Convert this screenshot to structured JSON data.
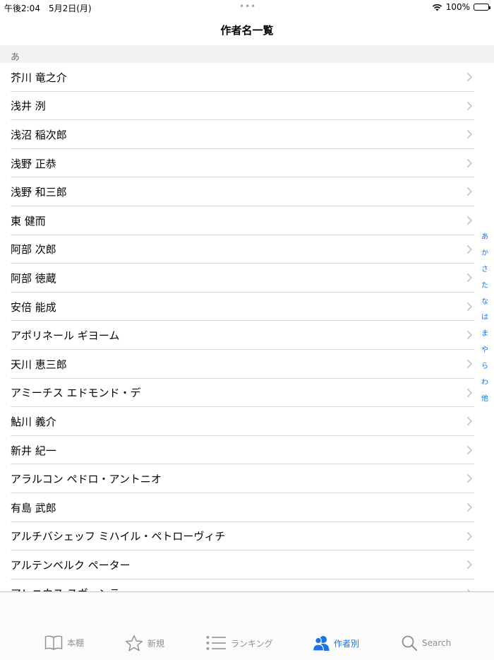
{
  "status_bar": {
    "time": "午後2:04　5月2日(月)",
    "dots": "•••",
    "battery_percent": "100%",
    "battery_level": 1.0
  },
  "nav": {
    "title": "作者名一覧"
  },
  "section": {
    "header": "あ"
  },
  "authors": [
    "芥川 竜之介",
    "浅井 洌",
    "浅沼 稲次郎",
    "浅野 正恭",
    "浅野 和三郎",
    "東 健而",
    "阿部 次郎",
    "阿部 徳蔵",
    "安倍 能成",
    "アポリネール ギヨーム",
    "天川 恵三郎",
    "アミーチス エドモンド・デ",
    "鮎川 義介",
    "新井 紀一",
    "アラルコン ペドロ・アントニオ",
    "有島 武郎",
    "アルチバシェッフ ミハイル・ペトローヴィチ",
    "アルテンベルク ペーター",
    "アレニウス スヴァンテ"
  ],
  "index": [
    "あ",
    "か",
    "さ",
    "た",
    "な",
    "は",
    "ま",
    "や",
    "ら",
    "わ",
    "他"
  ],
  "tabs": {
    "bookshelf": "本棚",
    "new": "新規",
    "ranking": "ランキング",
    "by_author": "作者別",
    "search": "Search"
  },
  "colors": {
    "accent": "#1a73e8",
    "inactive": "#8e8e93",
    "separator": "#dadadc"
  }
}
